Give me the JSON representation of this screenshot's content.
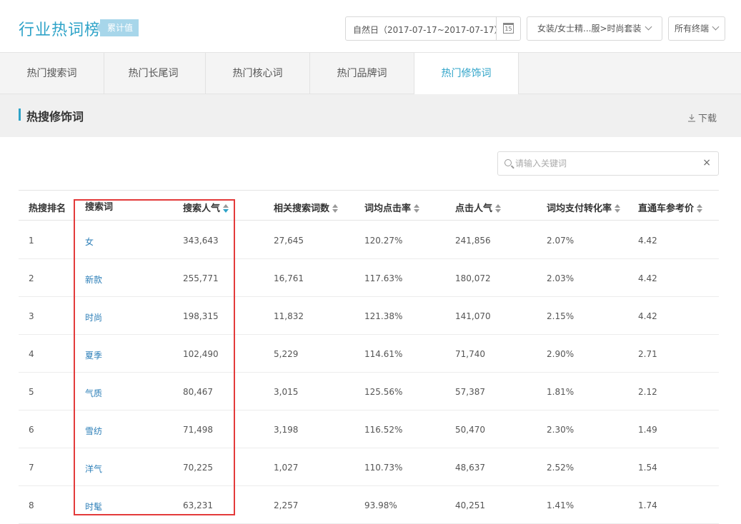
{
  "header": {
    "title": "行业热词榜",
    "badge": "累计值",
    "date_range": "自然日（2017-07-17~2017-07-17）",
    "calendar_day": "15",
    "category": "女装/女士精...服>时尚套装",
    "terminal": "所有终端"
  },
  "tabs": [
    {
      "label": "热门搜索词"
    },
    {
      "label": "热门长尾词"
    },
    {
      "label": "热门核心词"
    },
    {
      "label": "热门品牌词"
    },
    {
      "label": "热门修饰词"
    }
  ],
  "active_tab": "热门修饰词",
  "section": {
    "title": "热搜修饰词",
    "download": "下载"
  },
  "search": {
    "placeholder": "请输入关键词",
    "value": "",
    "clear": "×"
  },
  "table": {
    "columns": [
      "热搜排名",
      "搜索词",
      "搜索人气",
      "相关搜索词数",
      "词均点击率",
      "点击人气",
      "词均支付转化率",
      "直通车参考价"
    ],
    "rows": [
      [
        "1",
        "女",
        "343,643",
        "27,645",
        "120.27%",
        "241,856",
        "2.07%",
        "4.42"
      ],
      [
        "2",
        "新款",
        "255,771",
        "16,761",
        "117.63%",
        "180,072",
        "2.03%",
        "4.42"
      ],
      [
        "3",
        "时尚",
        "198,315",
        "11,832",
        "121.38%",
        "141,070",
        "2.15%",
        "4.42"
      ],
      [
        "4",
        "夏季",
        "102,490",
        "5,229",
        "114.61%",
        "71,740",
        "2.90%",
        "2.71"
      ],
      [
        "5",
        "气质",
        "80,467",
        "3,015",
        "125.56%",
        "57,387",
        "1.81%",
        "2.12"
      ],
      [
        "6",
        "雪纺",
        "71,498",
        "3,198",
        "116.52%",
        "50,470",
        "2.30%",
        "1.49"
      ],
      [
        "7",
        "洋气",
        "70,225",
        "1,027",
        "110.73%",
        "48,637",
        "2.52%",
        "1.54"
      ],
      [
        "8",
        "时髦",
        "63,231",
        "2,257",
        "93.98%",
        "40,251",
        "1.41%",
        "1.74"
      ]
    ]
  },
  "colors": {
    "accent": "#2ea3c8",
    "link": "#2d7fb8",
    "highlight_border": "#e33a3a"
  },
  "icons": [
    "calendar-icon",
    "chevron-down-icon",
    "download-icon",
    "search-icon",
    "close-icon",
    "sort-icon"
  ]
}
